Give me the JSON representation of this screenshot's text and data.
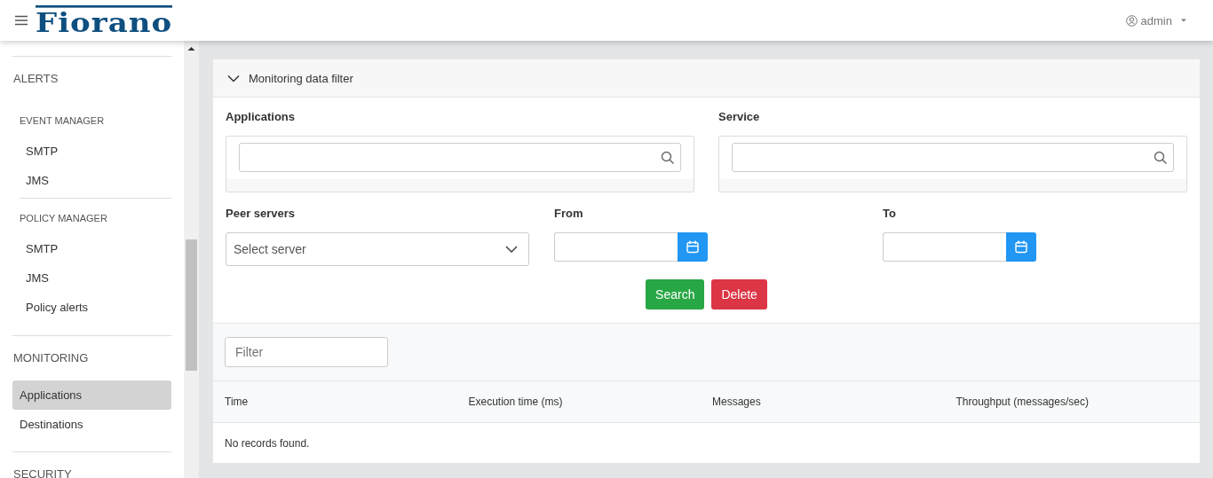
{
  "header": {
    "logo": "Fiorano",
    "user": "admin"
  },
  "sidebar": {
    "items": [
      {
        "kind": "section",
        "label": "ALERTS"
      },
      {
        "kind": "subsection",
        "label": "EVENT MANAGER"
      },
      {
        "kind": "link",
        "label": "SMTP",
        "selected": false
      },
      {
        "kind": "link",
        "label": "JMS",
        "selected": false
      },
      {
        "kind": "subsection",
        "label": "POLICY MANAGER"
      },
      {
        "kind": "link",
        "label": "SMTP",
        "selected": false
      },
      {
        "kind": "link",
        "label": "JMS",
        "selected": false
      },
      {
        "kind": "link",
        "label": "Policy alerts",
        "selected": false
      },
      {
        "kind": "section",
        "label": "MONITORING"
      },
      {
        "kind": "item",
        "label": "Applications",
        "selected": true
      },
      {
        "kind": "item",
        "label": "Destinations",
        "selected": false
      },
      {
        "kind": "section",
        "label": "SECURITY"
      }
    ]
  },
  "filter_panel": {
    "title": "Monitoring data filter",
    "expanded": true,
    "applications_label": "Applications",
    "service_label": "Service",
    "peer_servers_label": "Peer servers",
    "peer_servers": {
      "placeholder": "Select server"
    },
    "from_label": "From",
    "to_label": "To",
    "buttons": [
      {
        "label": "Search",
        "kind": "success"
      },
      {
        "label": "Delete",
        "kind": "danger"
      }
    ]
  },
  "table": {
    "filter": {
      "placeholder": "Filter"
    },
    "columns": [
      "Time",
      "Execution time (ms)",
      "Messages",
      "Throughput (messages/sec)"
    ],
    "empty_message": "No records found."
  }
}
